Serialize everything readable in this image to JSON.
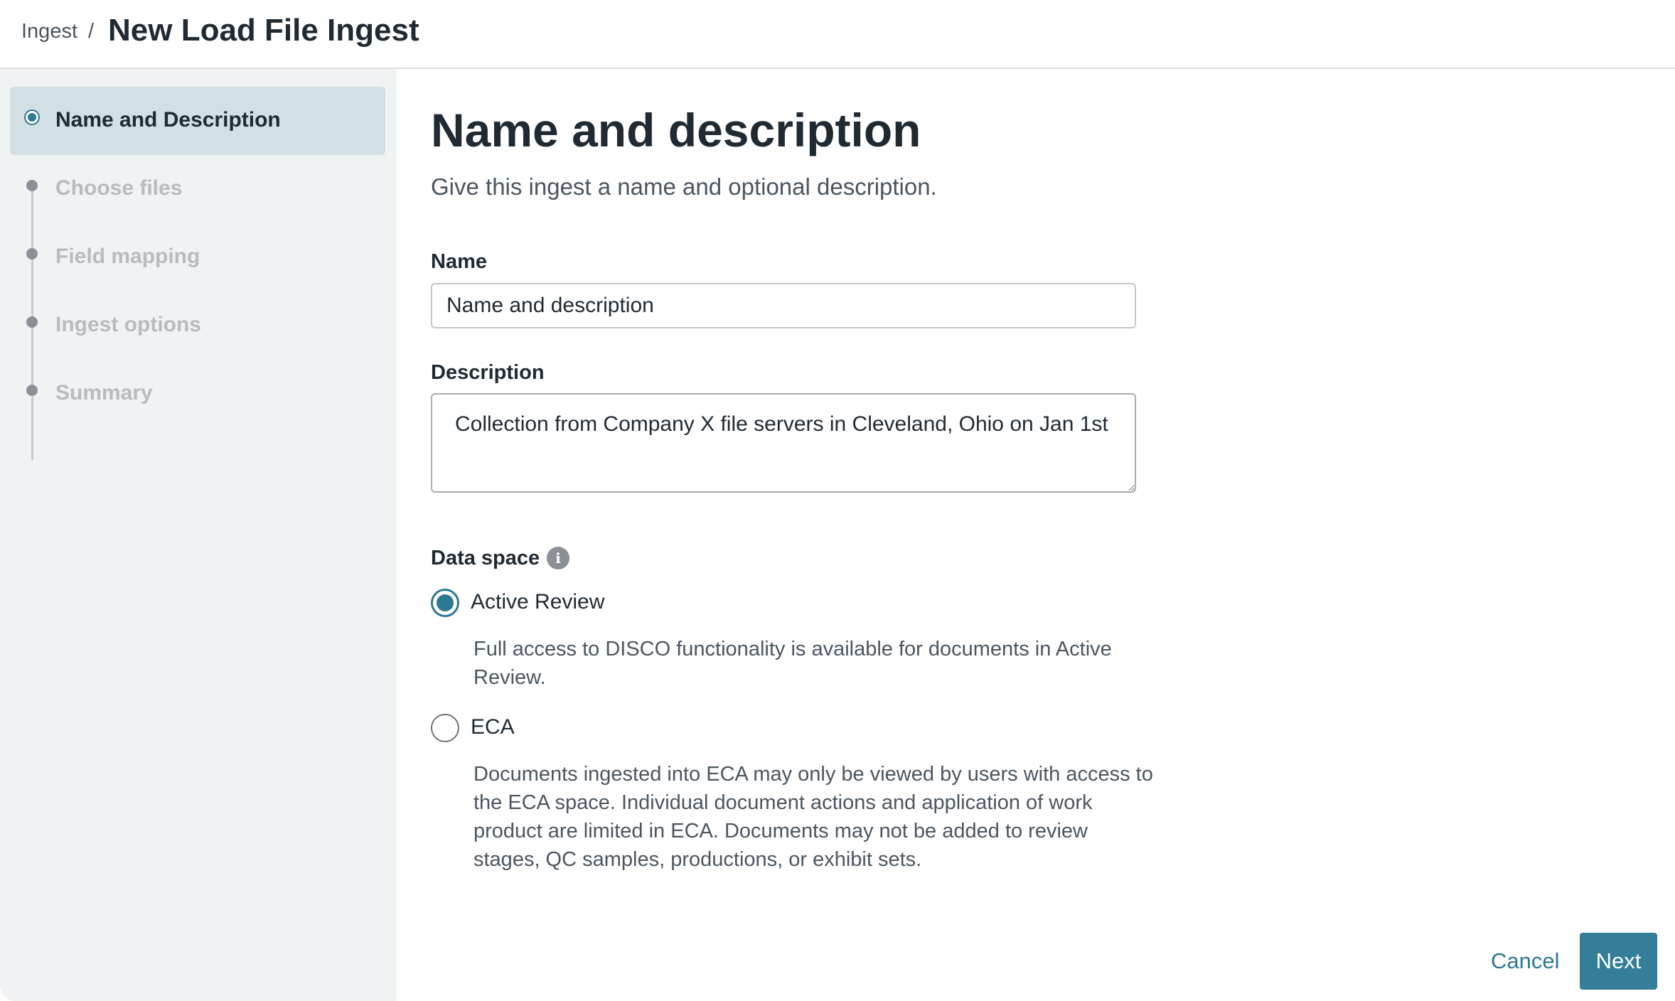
{
  "header": {
    "breadcrumb_root": "Ingest",
    "breadcrumb_separator": "/",
    "title": "New Load File Ingest"
  },
  "sidebar": {
    "steps": [
      {
        "label": "Name and Description",
        "state": "active"
      },
      {
        "label": "Choose files",
        "state": "disabled"
      },
      {
        "label": "Field mapping",
        "state": "disabled"
      },
      {
        "label": "Ingest options",
        "state": "disabled"
      },
      {
        "label": "Summary",
        "state": "disabled"
      }
    ]
  },
  "main": {
    "heading": "Name and description",
    "subtitle": "Give this ingest a name and optional description.",
    "name_label": "Name",
    "name_value": "Name and description",
    "description_label": "Description",
    "description_value": "Collection from Company X file servers in Cleveland, Ohio on Jan 1st",
    "data_space": {
      "label": "Data space",
      "info_icon": "info-icon",
      "selected": "Active Review",
      "options": [
        {
          "label": "Active Review",
          "checked": true,
          "description": "Full access to DISCO functionality is available for documents in Active Review."
        },
        {
          "label": "ECA",
          "checked": false,
          "description": "Documents ingested into ECA may only be viewed by users with access to the ECA space. Individual document actions and application of work product are limited in ECA. Documents may not be added to review stages, QC samples, productions, or exhibit sets."
        }
      ]
    }
  },
  "footer": {
    "cancel_label": "Cancel",
    "next_label": "Next"
  },
  "colors": {
    "accent": "#2d7893",
    "primary_button": "#357e99",
    "sidebar_bg": "#f1f2f3",
    "active_step_bg": "#d2dfe5"
  }
}
